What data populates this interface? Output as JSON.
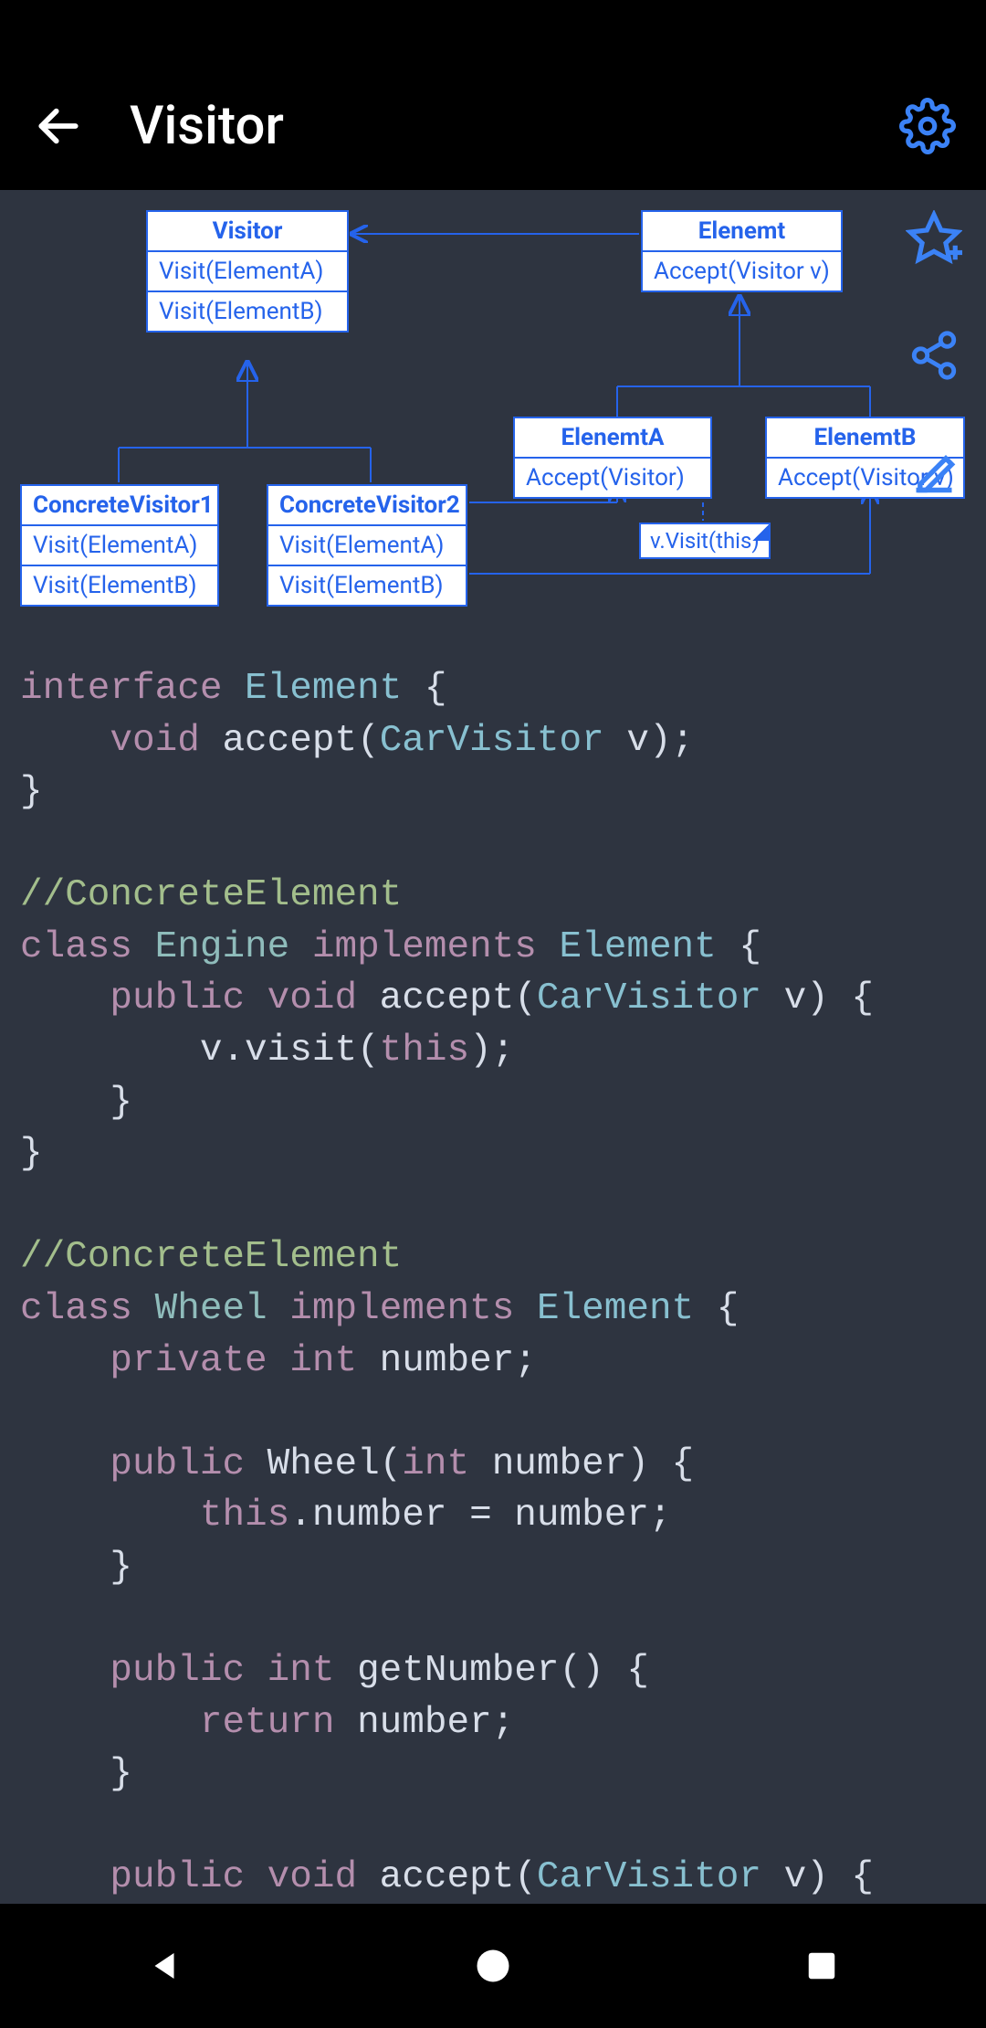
{
  "header": {
    "title": "Visitor"
  },
  "diagram": {
    "visitor": {
      "head": "Visitor",
      "m1": "Visit(ElementA)",
      "m2": "Visit(ElementB)"
    },
    "element": {
      "head": "Elenemt",
      "m1": "Accept(Visitor v)"
    },
    "cv1": {
      "head": "ConcreteVisitor1",
      "m1": "Visit(ElementA)",
      "m2": "Visit(ElementB)"
    },
    "cv2": {
      "head": "ConcreteVisitor2",
      "m1": "Visit(ElementA)",
      "m2": "Visit(ElementB)"
    },
    "ea": {
      "head": "ElenemtA",
      "m1": "Accept(Visitor)"
    },
    "eb": {
      "head": "ElenemtB",
      "m1": "Accept(Visitor v)"
    },
    "note": "v.Visit(this)"
  },
  "code": {
    "l1a": "interface",
    "l1b": "Element",
    "l1c": " {",
    "l2a": "    ",
    "l2b": "void",
    "l2c": " accept(",
    "l2d": "CarVisitor",
    "l2e": " v);",
    "l3": "}",
    "l5": "//ConcreteElement",
    "l6a": "class",
    "l6b": "Engine",
    "l6c": "implements",
    "l6d": "Element",
    "l6e": " {",
    "l7a": "    ",
    "l7b": "public",
    "l7c": "void",
    "l7d": " accept(",
    "l7e": "CarVisitor",
    "l7f": " v) {",
    "l8a": "        v.visit(",
    "l8b": "this",
    "l8c": ");",
    "l9": "    }",
    "l10": "}",
    "l12": "//ConcreteElement",
    "l13a": "class",
    "l13b": "Wheel",
    "l13c": "implements",
    "l13d": "Element",
    "l13e": " {",
    "l14a": "    ",
    "l14b": "private",
    "l14c": "int",
    "l14d": " number;",
    "l16a": "    ",
    "l16b": "public",
    "l16c": " Wheel(",
    "l16d": "int",
    "l16e": " number) {",
    "l17a": "        ",
    "l17b": "this",
    "l17c": ".number = number;",
    "l18": "    }",
    "l20a": "    ",
    "l20b": "public",
    "l20c": "int",
    "l20d": " getNumber() {",
    "l21a": "        ",
    "l21b": "return",
    "l21c": " number;",
    "l22": "    }",
    "l24a": "    ",
    "l24b": "public",
    "l24c": "void",
    "l24d": " accept(",
    "l24e": "CarVisitor",
    "l24f": " v) {"
  }
}
